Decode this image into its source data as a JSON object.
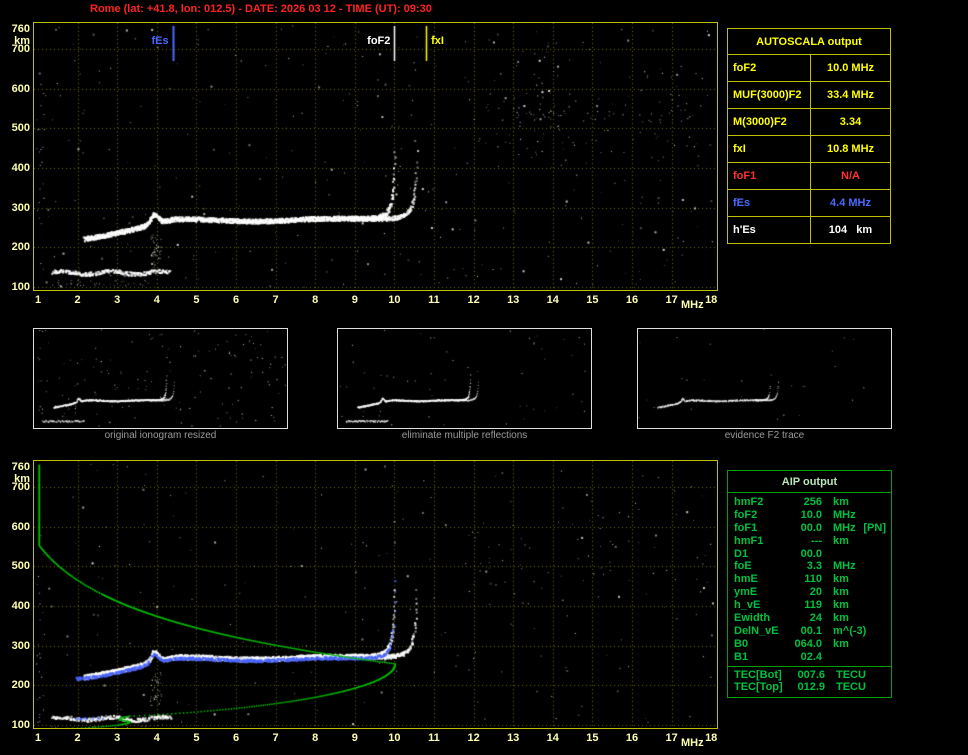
{
  "header": {
    "title": "Rome (lat: +41.8, lon: 012.5) - DATE: 2026 03 12 - TIME (UT): 09:30"
  },
  "axes": {
    "y_ticks": [
      "760",
      "700",
      "600",
      "500",
      "400",
      "300",
      "200",
      "100"
    ],
    "y_unit": "km",
    "x_ticks": [
      "1",
      "2",
      "3",
      "4",
      "5",
      "6",
      "7",
      "8",
      "9",
      "10",
      "11",
      "12",
      "13",
      "14",
      "15",
      "16",
      "17",
      "18"
    ],
    "x_unit": "MHz"
  },
  "main_ionogram": {
    "markers": [
      {
        "label": "fEs",
        "freq_mhz": 4.4,
        "color": "#4a6bff"
      },
      {
        "label": "foF2",
        "freq_mhz": 10.0,
        "color": "#ffffff"
      },
      {
        "label": "fxI",
        "freq_mhz": 10.8,
        "color": "#ffff00"
      }
    ]
  },
  "autoscala_table": {
    "title": "AUTOSCALA output",
    "rows": [
      {
        "label": "foF2",
        "value": "10.0 MHz",
        "color": "#ffff00"
      },
      {
        "label": "MUF(3000)F2",
        "value": "33.4 MHz",
        "color": "#ffff00"
      },
      {
        "label": "M(3000)F2",
        "value": "3.34",
        "color": "#ffff00"
      },
      {
        "label": "fxI",
        "value": "10.8 MHz",
        "color": "#ffff00"
      },
      {
        "label": "foF1",
        "value": "N/A",
        "color": "#ff3030"
      },
      {
        "label": "fEs",
        "value": "4.4 MHz",
        "color": "#4a6bff"
      },
      {
        "label": "h'Es",
        "value": "104   km",
        "color": "#ffffff"
      }
    ]
  },
  "thumbnails": [
    {
      "caption": "original ionogram resized"
    },
    {
      "caption": "eliminate multiple reflections"
    },
    {
      "caption": "evidence F2 trace"
    }
  ],
  "aip_table": {
    "title": "AIP output",
    "rows": [
      {
        "label": "hmF2",
        "value": "256",
        "unit": "km"
      },
      {
        "label": "foF2",
        "value": "10.0",
        "unit": "MHz"
      },
      {
        "label": "foF1",
        "value": "00.0",
        "unit": "MHz",
        "extra": "[PN]"
      },
      {
        "label": "hmF1",
        "value": "---",
        "unit": "km"
      },
      {
        "label": "D1",
        "value": "00.0",
        "unit": ""
      },
      {
        "label": "foE",
        "value": "3.3",
        "unit": "MHz"
      },
      {
        "label": "hmE",
        "value": "110",
        "unit": "km"
      },
      {
        "label": "ymE",
        "value": "20",
        "unit": "km"
      },
      {
        "label": "h_vE",
        "value": "119",
        "unit": "km"
      },
      {
        "label": "Ewidth",
        "value": "24",
        "unit": "km"
      },
      {
        "label": "DelN_vE",
        "value": "00.1",
        "unit": "m^(-3)"
      },
      {
        "label": "B0",
        "value": "064.0",
        "unit": "km"
      },
      {
        "label": "B1",
        "value": "02.4",
        "unit": ""
      }
    ],
    "tec_rows": [
      {
        "label": "TEC[Bot]",
        "value": "007.6",
        "unit": "TECU"
      },
      {
        "label": "TEC[Top]",
        "value": "012.9",
        "unit": "TECU"
      }
    ]
  },
  "colors": {
    "plot_border": "#c0c000",
    "grid": "#6a6a00",
    "axis_text": "#ffffb0",
    "title_text": "#ff2222",
    "trace_white": "#ffffff",
    "restored_blue": "#4863ff",
    "profile_green": "#00bb00"
  },
  "chart_data": [
    {
      "type": "scatter",
      "title": "ionogram with autoscaled characteristic frequencies",
      "xlabel": "MHz",
      "ylabel": "km",
      "xlim": [
        1,
        18
      ],
      "ylim": [
        100,
        760
      ],
      "annotations": [
        "fEs = 4.4 MHz",
        "foF2 = 10.0 MHz",
        "fxI = 10.8 MHz",
        "h'Es = 104 km"
      ],
      "series_desc": [
        "E/Es trace near 110-140 km (1.4-4.3 MHz)",
        "F trace ~260-270 km flat 4-9 MHz, asymptote to ~450 km at foF2 10.0 MHz",
        "X-mode branch asymptote at 10.8 MHz"
      ]
    },
    {
      "type": "scatter",
      "title": "ionogram with restored trace (blue) and electron density profile (green)",
      "xlabel": "MHz",
      "ylabel": "km",
      "xlim": [
        1,
        18
      ],
      "ylim": [
        100,
        760
      ],
      "annotations": [
        "hmF2 = 256 km",
        "foF2 = 10.0 MHz",
        "foE = 3.3 MHz",
        "hmE = 110 km"
      ],
      "series_desc": [
        "same ionogram echoes",
        "restored F-trace in blue up to ~490 km",
        "Ne profile: topside from 760 km down to peak (10 MHz @ 256 km), bottomside to E layer (3.3 MHz @ 110 km)"
      ]
    }
  ]
}
